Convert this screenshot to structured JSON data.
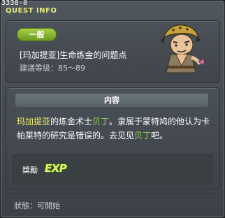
{
  "window": {
    "quest_id": "3338-0",
    "title": "QUEST INFO"
  },
  "header": {
    "badge": "一般",
    "quest_name": "[玛加提亚]生命炼金的问题点",
    "level_req": "建議等级：85～89",
    "npc_icon": "alchemist-npc-portrait"
  },
  "content": {
    "section_title": "内容",
    "desc_parts": [
      "玛加提亚",
      "的炼金术士",
      "贝丁",
      "。隶属于蒙特鸠的他认为卡帕莱特的研究是错误的。去见见",
      "贝丁",
      "吧。"
    ],
    "reward_label": "獎勵",
    "reward_icon_text": "EXP"
  },
  "footer": {
    "status": "狀態：可開始"
  },
  "colors": {
    "title": "#e8ee7a",
    "highlight_yellow": "#f2f26a",
    "highlight_green": "#8fdc4e",
    "badge_green": "#8fbc30"
  }
}
